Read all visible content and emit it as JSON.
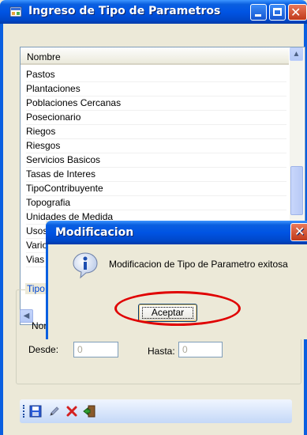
{
  "window": {
    "title": "Ingreso de Tipo de Parametros"
  },
  "list": {
    "column_header": "Nombre",
    "items": [
      "Pastos",
      "Plantaciones",
      "Poblaciones Cercanas",
      "Posecionario",
      "Riegos",
      "Riesgos",
      "Servicios Basicos",
      "Tasas de Interes",
      "TipoContribuyente",
      "Topografia",
      "Unidades de Medida",
      "Usos",
      "Vario",
      "Vias"
    ]
  },
  "group": {
    "title_partial": "Tipo",
    "name_label_partial": "Nor",
    "from_label": "Desde:",
    "from_value": "0",
    "to_label": "Hasta:",
    "to_value": "0"
  },
  "toolbar": {
    "icons": [
      "save-icon",
      "edit-icon",
      "delete-icon",
      "exit-icon"
    ]
  },
  "dialog": {
    "title": "Modificacion",
    "message": "Modificacion de Tipo de Parametro exitosa",
    "ok_label": "Aceptar",
    "icon": "info-icon"
  },
  "colors": {
    "titlebar": "#0054e3",
    "annotation_ellipse": "#e00000",
    "group_title": "#0046d5"
  }
}
